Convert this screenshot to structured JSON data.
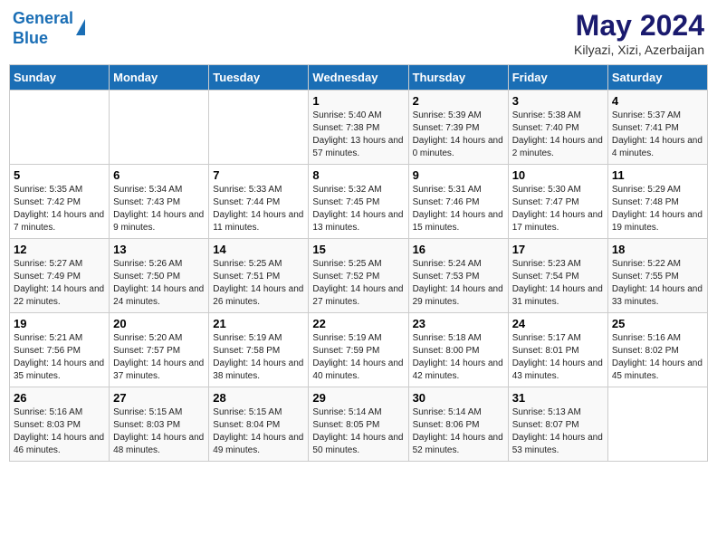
{
  "header": {
    "logo_line1": "General",
    "logo_line2": "Blue",
    "main_title": "May 2024",
    "subtitle": "Kilyazi, Xizi, Azerbaijan"
  },
  "weekdays": [
    "Sunday",
    "Monday",
    "Tuesday",
    "Wednesday",
    "Thursday",
    "Friday",
    "Saturday"
  ],
  "weeks": [
    [
      {
        "day": "",
        "info": ""
      },
      {
        "day": "",
        "info": ""
      },
      {
        "day": "",
        "info": ""
      },
      {
        "day": "1",
        "info": "Sunrise: 5:40 AM\nSunset: 7:38 PM\nDaylight: 13 hours and 57 minutes."
      },
      {
        "day": "2",
        "info": "Sunrise: 5:39 AM\nSunset: 7:39 PM\nDaylight: 14 hours and 0 minutes."
      },
      {
        "day": "3",
        "info": "Sunrise: 5:38 AM\nSunset: 7:40 PM\nDaylight: 14 hours and 2 minutes."
      },
      {
        "day": "4",
        "info": "Sunrise: 5:37 AM\nSunset: 7:41 PM\nDaylight: 14 hours and 4 minutes."
      }
    ],
    [
      {
        "day": "5",
        "info": "Sunrise: 5:35 AM\nSunset: 7:42 PM\nDaylight: 14 hours and 7 minutes."
      },
      {
        "day": "6",
        "info": "Sunrise: 5:34 AM\nSunset: 7:43 PM\nDaylight: 14 hours and 9 minutes."
      },
      {
        "day": "7",
        "info": "Sunrise: 5:33 AM\nSunset: 7:44 PM\nDaylight: 14 hours and 11 minutes."
      },
      {
        "day": "8",
        "info": "Sunrise: 5:32 AM\nSunset: 7:45 PM\nDaylight: 14 hours and 13 minutes."
      },
      {
        "day": "9",
        "info": "Sunrise: 5:31 AM\nSunset: 7:46 PM\nDaylight: 14 hours and 15 minutes."
      },
      {
        "day": "10",
        "info": "Sunrise: 5:30 AM\nSunset: 7:47 PM\nDaylight: 14 hours and 17 minutes."
      },
      {
        "day": "11",
        "info": "Sunrise: 5:29 AM\nSunset: 7:48 PM\nDaylight: 14 hours and 19 minutes."
      }
    ],
    [
      {
        "day": "12",
        "info": "Sunrise: 5:27 AM\nSunset: 7:49 PM\nDaylight: 14 hours and 22 minutes."
      },
      {
        "day": "13",
        "info": "Sunrise: 5:26 AM\nSunset: 7:50 PM\nDaylight: 14 hours and 24 minutes."
      },
      {
        "day": "14",
        "info": "Sunrise: 5:25 AM\nSunset: 7:51 PM\nDaylight: 14 hours and 26 minutes."
      },
      {
        "day": "15",
        "info": "Sunrise: 5:25 AM\nSunset: 7:52 PM\nDaylight: 14 hours and 27 minutes."
      },
      {
        "day": "16",
        "info": "Sunrise: 5:24 AM\nSunset: 7:53 PM\nDaylight: 14 hours and 29 minutes."
      },
      {
        "day": "17",
        "info": "Sunrise: 5:23 AM\nSunset: 7:54 PM\nDaylight: 14 hours and 31 minutes."
      },
      {
        "day": "18",
        "info": "Sunrise: 5:22 AM\nSunset: 7:55 PM\nDaylight: 14 hours and 33 minutes."
      }
    ],
    [
      {
        "day": "19",
        "info": "Sunrise: 5:21 AM\nSunset: 7:56 PM\nDaylight: 14 hours and 35 minutes."
      },
      {
        "day": "20",
        "info": "Sunrise: 5:20 AM\nSunset: 7:57 PM\nDaylight: 14 hours and 37 minutes."
      },
      {
        "day": "21",
        "info": "Sunrise: 5:19 AM\nSunset: 7:58 PM\nDaylight: 14 hours and 38 minutes."
      },
      {
        "day": "22",
        "info": "Sunrise: 5:19 AM\nSunset: 7:59 PM\nDaylight: 14 hours and 40 minutes."
      },
      {
        "day": "23",
        "info": "Sunrise: 5:18 AM\nSunset: 8:00 PM\nDaylight: 14 hours and 42 minutes."
      },
      {
        "day": "24",
        "info": "Sunrise: 5:17 AM\nSunset: 8:01 PM\nDaylight: 14 hours and 43 minutes."
      },
      {
        "day": "25",
        "info": "Sunrise: 5:16 AM\nSunset: 8:02 PM\nDaylight: 14 hours and 45 minutes."
      }
    ],
    [
      {
        "day": "26",
        "info": "Sunrise: 5:16 AM\nSunset: 8:03 PM\nDaylight: 14 hours and 46 minutes."
      },
      {
        "day": "27",
        "info": "Sunrise: 5:15 AM\nSunset: 8:03 PM\nDaylight: 14 hours and 48 minutes."
      },
      {
        "day": "28",
        "info": "Sunrise: 5:15 AM\nSunset: 8:04 PM\nDaylight: 14 hours and 49 minutes."
      },
      {
        "day": "29",
        "info": "Sunrise: 5:14 AM\nSunset: 8:05 PM\nDaylight: 14 hours and 50 minutes."
      },
      {
        "day": "30",
        "info": "Sunrise: 5:14 AM\nSunset: 8:06 PM\nDaylight: 14 hours and 52 minutes."
      },
      {
        "day": "31",
        "info": "Sunrise: 5:13 AM\nSunset: 8:07 PM\nDaylight: 14 hours and 53 minutes."
      },
      {
        "day": "",
        "info": ""
      }
    ]
  ]
}
